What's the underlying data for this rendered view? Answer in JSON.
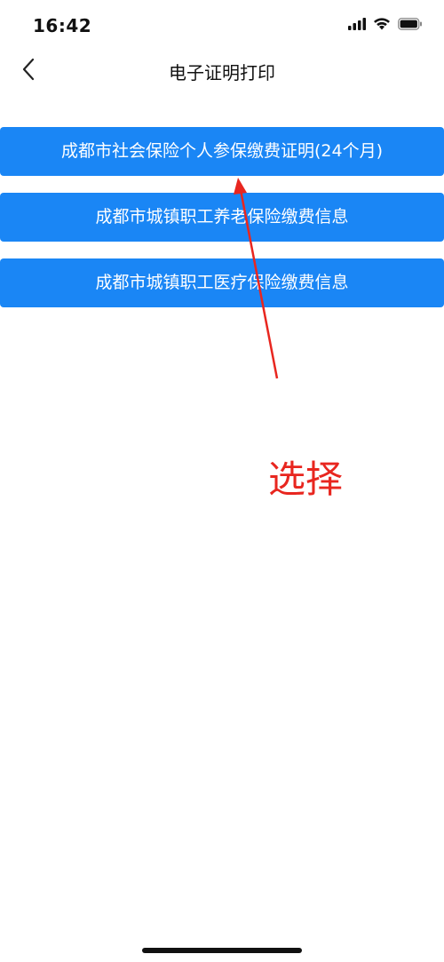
{
  "status_bar": {
    "time": "16:42",
    "icons": [
      "signal-icon",
      "wifi-icon",
      "battery-icon"
    ]
  },
  "nav": {
    "title": "电子证明打印",
    "back_icon": "chevron-left-icon"
  },
  "options": [
    {
      "label": "成都市社会保险个人参保缴费证明(24个月)"
    },
    {
      "label": "成都市城镇职工养老保险缴费信息"
    },
    {
      "label": "成都市城镇职工医疗保险缴费信息"
    }
  ],
  "annotation": {
    "text": "选择",
    "color": "#e8261f"
  },
  "colors": {
    "button_blue": "#1a86f5",
    "background": "#ffffff"
  }
}
